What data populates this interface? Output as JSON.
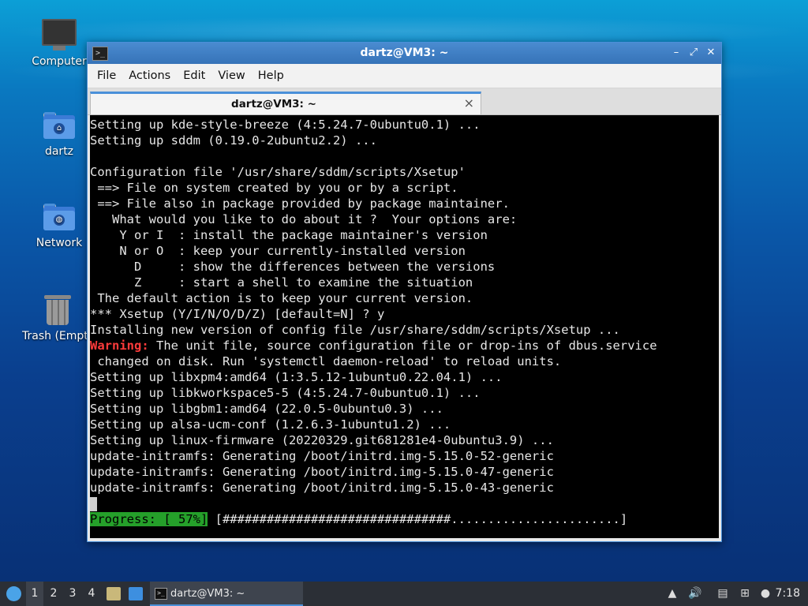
{
  "desktop": {
    "icons": [
      {
        "label": "Computer"
      },
      {
        "label": "dartz"
      },
      {
        "label": "Network"
      },
      {
        "label": "Trash (Empty)"
      }
    ]
  },
  "window": {
    "title": "dartz@VM3: ~",
    "menu": [
      "File",
      "Actions",
      "Edit",
      "View",
      "Help"
    ],
    "tab_label": "dartz@VM3: ~",
    "controls": {
      "minimize": "–",
      "restore": "⤢",
      "close": "✕"
    }
  },
  "terminal": {
    "lines": [
      "Setting up kde-style-breeze (4:5.24.7-0ubuntu0.1) ...",
      "Setting up sddm (0.19.0-2ubuntu2.2) ...",
      "",
      "Configuration file '/usr/share/sddm/scripts/Xsetup'",
      " ==> File on system created by you or by a script.",
      " ==> File also in package provided by package maintainer.",
      "   What would you like to do about it ?  Your options are:",
      "    Y or I  : install the package maintainer's version",
      "    N or O  : keep your currently-installed version",
      "      D     : show the differences between the versions",
      "      Z     : start a shell to examine the situation",
      " The default action is to keep your current version.",
      "*** Xsetup (Y/I/N/O/D/Z) [default=N] ? y",
      "Installing new version of config file /usr/share/sddm/scripts/Xsetup ..."
    ],
    "warning_label": "Warning:",
    "warning_text": " The unit file, source configuration file or drop-ins of dbus.service",
    "lines_after": [
      " changed on disk. Run 'systemctl daemon-reload' to reload units.",
      "Setting up libxpm4:amd64 (1:3.5.12-1ubuntu0.22.04.1) ...",
      "Setting up libkworkspace5-5 (4:5.24.7-0ubuntu0.1) ...",
      "Setting up libgbm1:amd64 (22.0.5-0ubuntu0.3) ...",
      "Setting up alsa-ucm-conf (1.2.6.3-1ubuntu1.2) ...",
      "Setting up linux-firmware (20220329.git681281e4-0ubuntu3.9) ...",
      "update-initramfs: Generating /boot/initrd.img-5.15.0-52-generic",
      "update-initramfs: Generating /boot/initrd.img-5.15.0-47-generic",
      "update-initramfs: Generating /boot/initrd.img-5.15.0-43-generic"
    ],
    "progress_label": "Progress: [ 57%]",
    "progress_bar": " [###############################.......................]",
    "progress_percent": 57
  },
  "taskbar": {
    "workspaces": [
      "1",
      "2",
      "3",
      "4"
    ],
    "active_workspace": "1",
    "task_label": "dartz@VM3: ~",
    "clock": "7:18"
  },
  "colors": {
    "titlebar": "#3c7fc7",
    "warning": "#ff3b3b",
    "progress": "#25a02a",
    "taskbar": "#2b2f36"
  }
}
